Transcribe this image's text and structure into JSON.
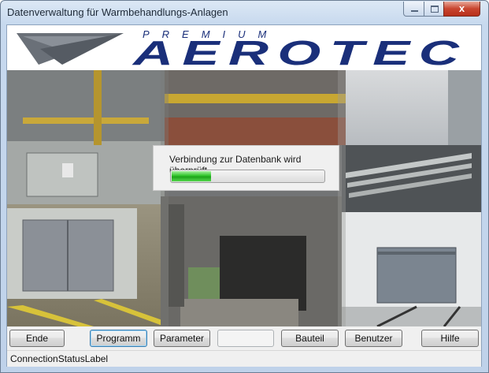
{
  "window": {
    "title": "Datenverwaltung für Warmbehandlungs-Anlagen",
    "close_glyph": "x"
  },
  "logo": {
    "tagline": "PREMIUM",
    "brand": "AEROTEC",
    "brand_color": "#1a2f7a",
    "bird_color": "#6a7078"
  },
  "progress": {
    "label": "Verbindung zur Datenbank wird überprüft",
    "value_fraction": 0.26,
    "color": "#2fc42a"
  },
  "buttons": {
    "ende": "Ende",
    "programm": "Programm",
    "parameter": "Parameter",
    "blank": "",
    "bauteil": "Bauteil",
    "benutzer": "Benutzer",
    "hilfe": "Hilfe"
  },
  "status": {
    "label": "ConnectionStatusLabel"
  }
}
